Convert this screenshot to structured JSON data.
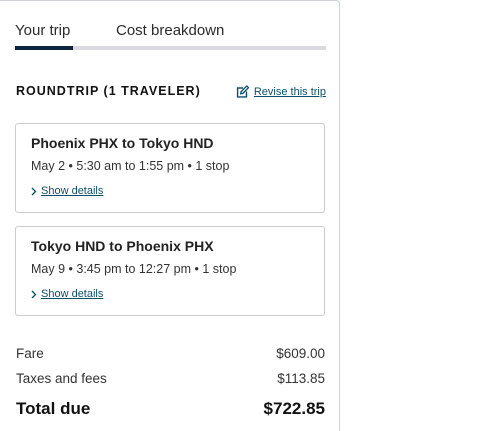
{
  "tabs": [
    {
      "label": "Your trip",
      "active": true
    },
    {
      "label": "Cost breakdown",
      "active": false
    }
  ],
  "trip": {
    "type_label": "ROUNDTRIP (1 TRAVELER)",
    "revise_label": "Revise this trip",
    "revise_icon": "edit-icon"
  },
  "flights": [
    {
      "route": "Phoenix PHX to Tokyo HND",
      "times": "May 2 • 5:30 am to 1:55 pm • 1 stop",
      "details_label": "Show details"
    },
    {
      "route": "Tokyo HND to Phoenix PHX",
      "times": "May 9 • 3:45 pm to 12:27 pm • 1 stop",
      "details_label": "Show details"
    }
  ],
  "pricing": {
    "fare_label": "Fare",
    "fare_value": "$609.00",
    "taxes_label": "Taxes and fees",
    "taxes_value": "$113.85",
    "total_label": "Total due",
    "total_value": "$722.85"
  },
  "colors": {
    "accent": "#0c2340",
    "link": "#0b4f6c",
    "border": "#c9ccd0"
  }
}
